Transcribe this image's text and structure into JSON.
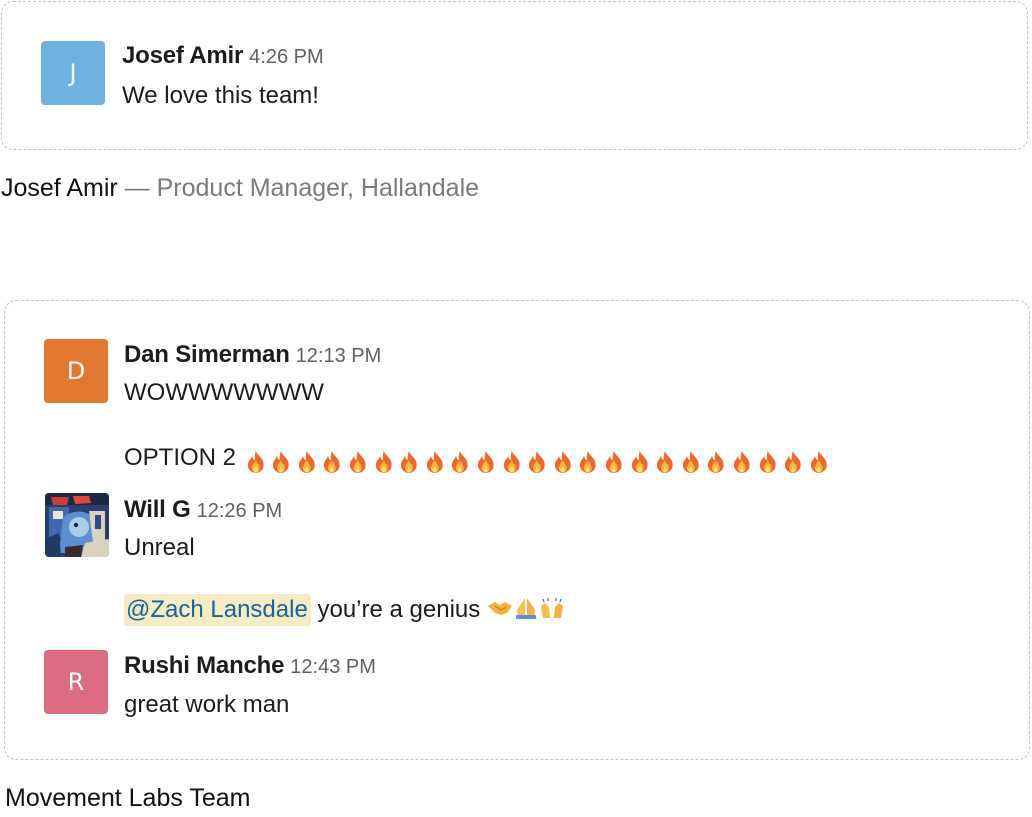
{
  "card1": {
    "messages": [
      {
        "avatar_letter": "J",
        "avatar_color": "#6cb3e0",
        "name": "Josef Amir",
        "time": "4:26 PM",
        "text": "We love this team!"
      }
    ]
  },
  "caption": {
    "name": "Josef Amir",
    "role": "— Product Manager, Hallandale"
  },
  "card2": {
    "messages": [
      {
        "avatar_letter": "D",
        "avatar_color": "#e27830",
        "name": "Dan Simerman",
        "time": "12:13 PM",
        "line1": "WOWWWWWWW",
        "line2": "OPTION 2",
        "fire_count": 23
      },
      {
        "avatar_icon": "profile-photo",
        "name": "Will G",
        "time": "12:26 PM",
        "line1": "Unreal",
        "mention": "@Zach Lansdale",
        "line2": "you’re a genius"
      },
      {
        "avatar_letter": "R",
        "avatar_color": "#dc6c80",
        "name": "Rushi Manche",
        "time": "12:43 PM",
        "text": "great work man"
      }
    ]
  },
  "footer": {
    "team": "Movement Labs Team"
  }
}
